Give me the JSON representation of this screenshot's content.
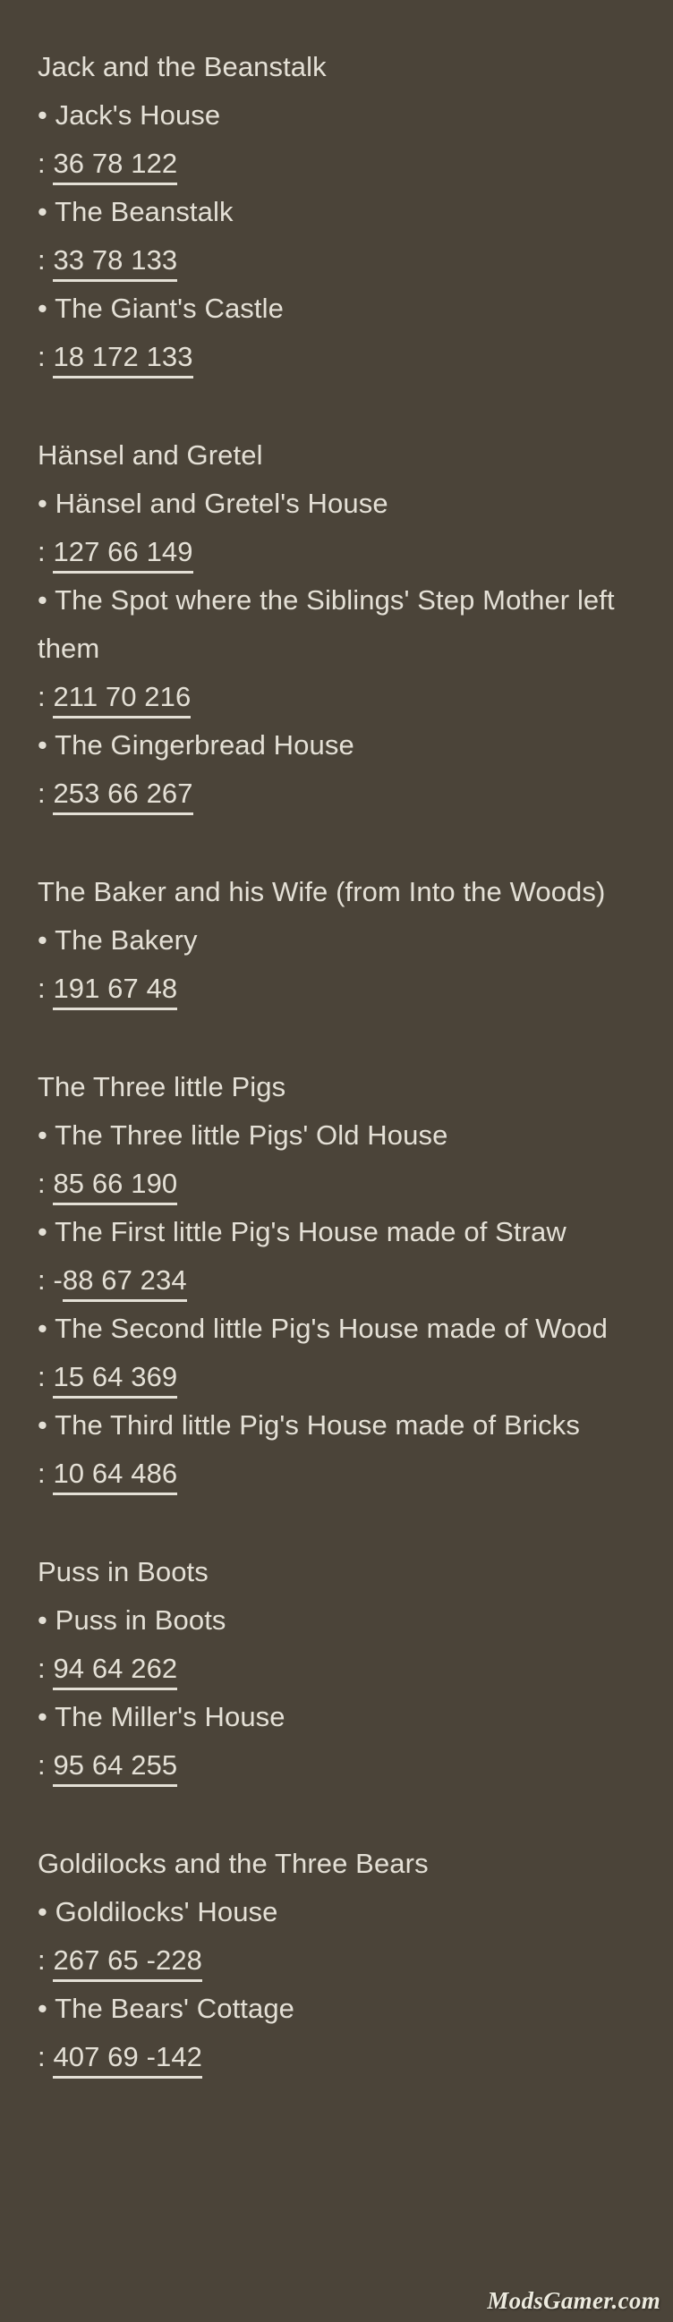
{
  "background_color": "#4b4439",
  "text_color": "#e4e0d6",
  "watermark": {
    "text": "ModsGamer.com"
  },
  "sections": [
    {
      "title": "Jack and the Beanstalk",
      "entries": [
        {
          "bullet": "•",
          "name": " Jack's House",
          "colon": ":",
          "sign": "",
          "coords": "36 78 122"
        },
        {
          "bullet": "•",
          "name": " The Beanstalk",
          "colon": ":",
          "sign": "",
          "coords": "33 78 133"
        },
        {
          "bullet": "•",
          "name": " The Giant's Castle",
          "colon": ":",
          "sign": "",
          "coords": "18 172 133"
        }
      ]
    },
    {
      "title": "Hänsel and Gretel",
      "entries": [
        {
          "bullet": "•",
          "name": " Hänsel and Gretel's House",
          "colon": ":",
          "sign": "",
          "coords": "127 66 149"
        },
        {
          "bullet": "•",
          "name": " The Spot where the Siblings' Step Mother left them",
          "colon": ":",
          "sign": "",
          "coords": "211 70 216"
        },
        {
          "bullet": "•",
          "name": " The Gingerbread House",
          "colon": ":",
          "sign": "",
          "coords": "253 66 267"
        }
      ]
    },
    {
      "title": "The Baker and his Wife (from Into the Woods)",
      "entries": [
        {
          "bullet": "•",
          "name": " The Bakery",
          "colon": ":",
          "sign": "",
          "coords": "191 67 48"
        }
      ]
    },
    {
      "title": "The Three little Pigs",
      "entries": [
        {
          "bullet": "•",
          "name": " The Three little Pigs' Old House",
          "colon": ":",
          "sign": "",
          "coords": "85 66 190"
        },
        {
          "bullet": "•",
          "name": " The First little Pig's House made of Straw",
          "colon": ":",
          "sign": "-",
          "coords": "88 67 234"
        },
        {
          "bullet": "•",
          "name": " The Second little Pig's House made of Wood",
          "colon": ":",
          "sign": "",
          "coords": "15 64 369"
        },
        {
          "bullet": "•",
          "name": " The Third little Pig's House made of Bricks",
          "colon": ":",
          "sign": "",
          "coords": "10 64 486"
        }
      ]
    },
    {
      "title": "Puss in Boots",
      "entries": [
        {
          "bullet": "•",
          "name": " Puss in Boots",
          "colon": ":",
          "sign": "",
          "coords": "94 64 262"
        },
        {
          "bullet": "•",
          "name": " The Miller's House",
          "colon": ":",
          "sign": "",
          "coords": "95 64 255"
        }
      ]
    },
    {
      "title": "Goldilocks and the Three Bears",
      "entries": [
        {
          "bullet": "•",
          "name": " Goldilocks' House",
          "colon": ":",
          "sign": "",
          "coords": "267 65 -228"
        },
        {
          "bullet": "•",
          "name": " The Bears' Cottage",
          "colon": ":",
          "sign": "",
          "coords": "407 69 -142"
        }
      ]
    }
  ]
}
